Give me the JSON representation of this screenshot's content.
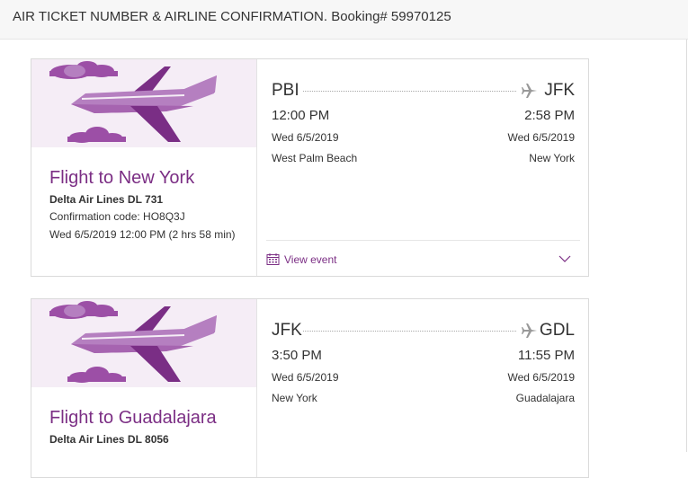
{
  "header": {
    "title": "AIR TICKET NUMBER & AIRLINE CONFIRMATION. Booking# 59970125"
  },
  "flights": [
    {
      "title": "Flight to New York",
      "airline": "Delta Air Lines DL 731",
      "confirmation": "Confirmation code: HO8Q3J",
      "when": "Wed 6/5/2019 12:00 PM (2 hrs 58 min)",
      "origin": {
        "code": "PBI",
        "time": "12:00 PM",
        "date": "Wed 6/5/2019",
        "city": "West Palm Beach"
      },
      "destination": {
        "code": "JFK",
        "time": "2:58 PM",
        "date": "Wed 6/5/2019",
        "city": "New York"
      },
      "view_event_label": "View event"
    },
    {
      "title": "Flight to Guadalajara",
      "airline": "Delta Air Lines DL 8056",
      "origin": {
        "code": "JFK",
        "time": "3:50 PM",
        "date": "Wed 6/5/2019",
        "city": "New York"
      },
      "destination": {
        "code": "GDL",
        "time": "11:55 PM",
        "date": "Wed 6/5/2019",
        "city": "Guadalajara"
      }
    }
  ],
  "colors": {
    "accent": "#7b2e84",
    "banner_bg": "#f5edf6",
    "plane_light": "#b57fc0",
    "plane_dark": "#7a2e85",
    "cloud": "#9c4fa6"
  },
  "icons": {
    "banner": "plane-illustration",
    "route": "plane-icon",
    "event": "calendar-icon",
    "expand": "chevron-down-icon"
  }
}
